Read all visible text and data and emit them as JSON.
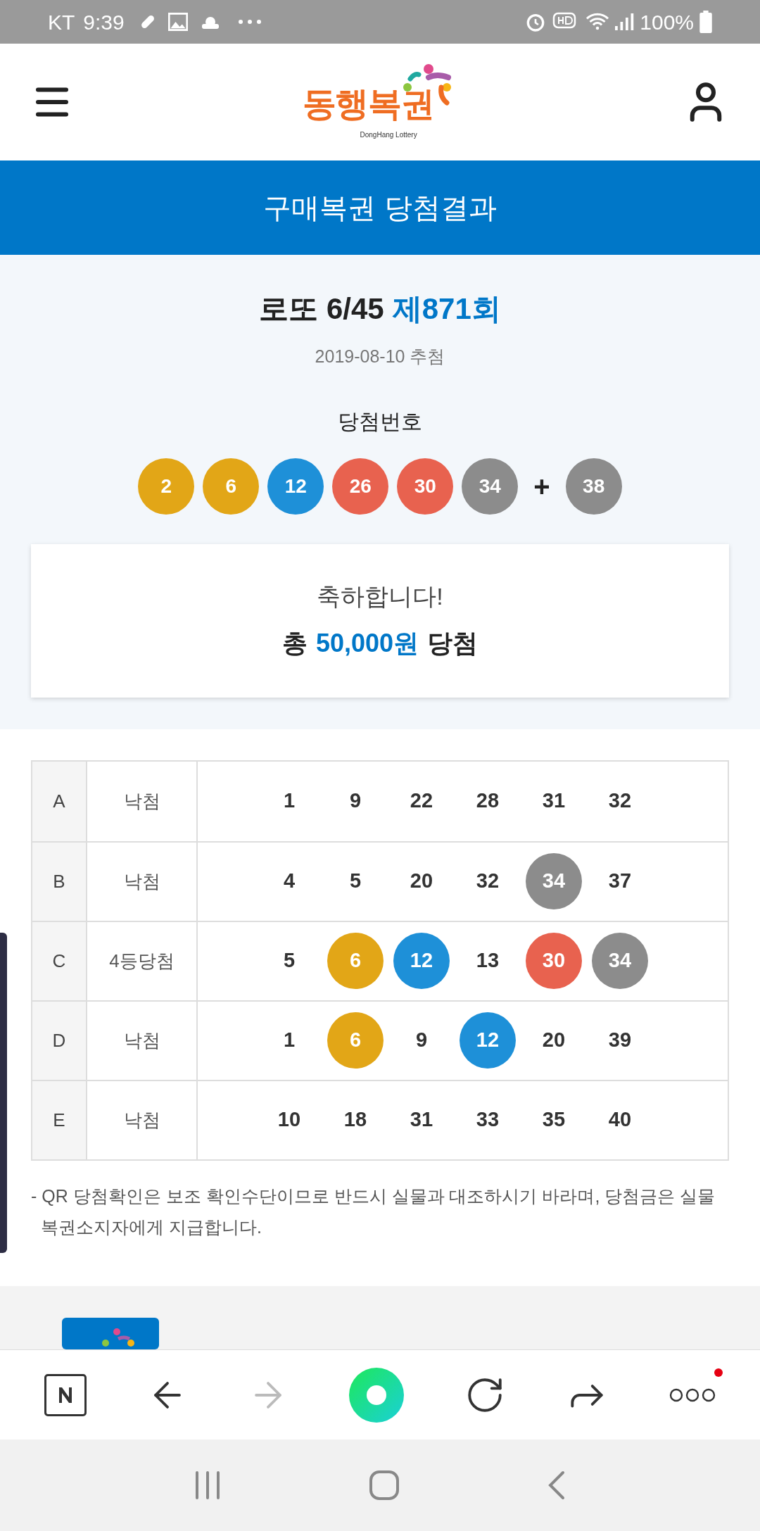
{
  "status_bar": {
    "carrier": "KT",
    "time": "9:39",
    "battery": "100%"
  },
  "header": {
    "logo_text": "동행복권",
    "logo_subtext": "DongHang Lottery"
  },
  "banner": {
    "title": "구매복권 당첨결과"
  },
  "draw": {
    "game": "로또 6/45",
    "round": "제871회",
    "date": "2019-08-10 추첨",
    "numbers_label": "당첨번호",
    "balls": [
      {
        "text": "2",
        "color": "#e2a617"
      },
      {
        "text": "6",
        "color": "#e2a617"
      },
      {
        "text": "12",
        "color": "#1e90d8"
      },
      {
        "text": "26",
        "color": "#e8624f"
      },
      {
        "text": "30",
        "color": "#e8624f"
      },
      {
        "text": "34",
        "color": "#8c8c8c"
      }
    ],
    "plus": "+",
    "bonus": {
      "text": "38",
      "color": "#8c8c8c"
    }
  },
  "result": {
    "greeting": "축하합니다!",
    "prize_prefix": "총",
    "prize_amount": "50,000원",
    "prize_suffix": "당첨"
  },
  "tickets": [
    {
      "game": "A",
      "result": "낙첨",
      "numbers": [
        {
          "text": "1",
          "matched": false
        },
        {
          "text": "9",
          "matched": false
        },
        {
          "text": "22",
          "matched": false
        },
        {
          "text": "28",
          "matched": false
        },
        {
          "text": "31",
          "matched": false
        },
        {
          "text": "32",
          "matched": false
        }
      ]
    },
    {
      "game": "B",
      "result": "낙첨",
      "numbers": [
        {
          "text": "4",
          "matched": false
        },
        {
          "text": "5",
          "matched": false
        },
        {
          "text": "20",
          "matched": false
        },
        {
          "text": "32",
          "matched": false
        },
        {
          "text": "34",
          "matched": true,
          "color": "#8c8c8c"
        },
        {
          "text": "37",
          "matched": false
        }
      ]
    },
    {
      "game": "C",
      "result": "4등당첨",
      "numbers": [
        {
          "text": "5",
          "matched": false
        },
        {
          "text": "6",
          "matched": true,
          "color": "#e2a617"
        },
        {
          "text": "12",
          "matched": true,
          "color": "#1e90d8"
        },
        {
          "text": "13",
          "matched": false
        },
        {
          "text": "30",
          "matched": true,
          "color": "#e8624f"
        },
        {
          "text": "34",
          "matched": true,
          "color": "#8c8c8c"
        }
      ]
    },
    {
      "game": "D",
      "result": "낙첨",
      "numbers": [
        {
          "text": "1",
          "matched": false
        },
        {
          "text": "6",
          "matched": true,
          "color": "#e2a617"
        },
        {
          "text": "9",
          "matched": false
        },
        {
          "text": "12",
          "matched": true,
          "color": "#1e90d8"
        },
        {
          "text": "20",
          "matched": false
        },
        {
          "text": "39",
          "matched": false
        }
      ]
    },
    {
      "game": "E",
      "result": "낙첨",
      "numbers": [
        {
          "text": "10",
          "matched": false
        },
        {
          "text": "18",
          "matched": false
        },
        {
          "text": "31",
          "matched": false
        },
        {
          "text": "33",
          "matched": false
        },
        {
          "text": "35",
          "matched": false
        },
        {
          "text": "40",
          "matched": false
        }
      ]
    }
  ],
  "note": "- QR 당첨확인은 보조 확인수단이므로 반드시 실물과 대조하시기 바라며, 당첨금은 실물 복권소지자에게 지급합니다.",
  "browser_bar": {
    "forward_disabled": true,
    "menu_badge": true
  }
}
